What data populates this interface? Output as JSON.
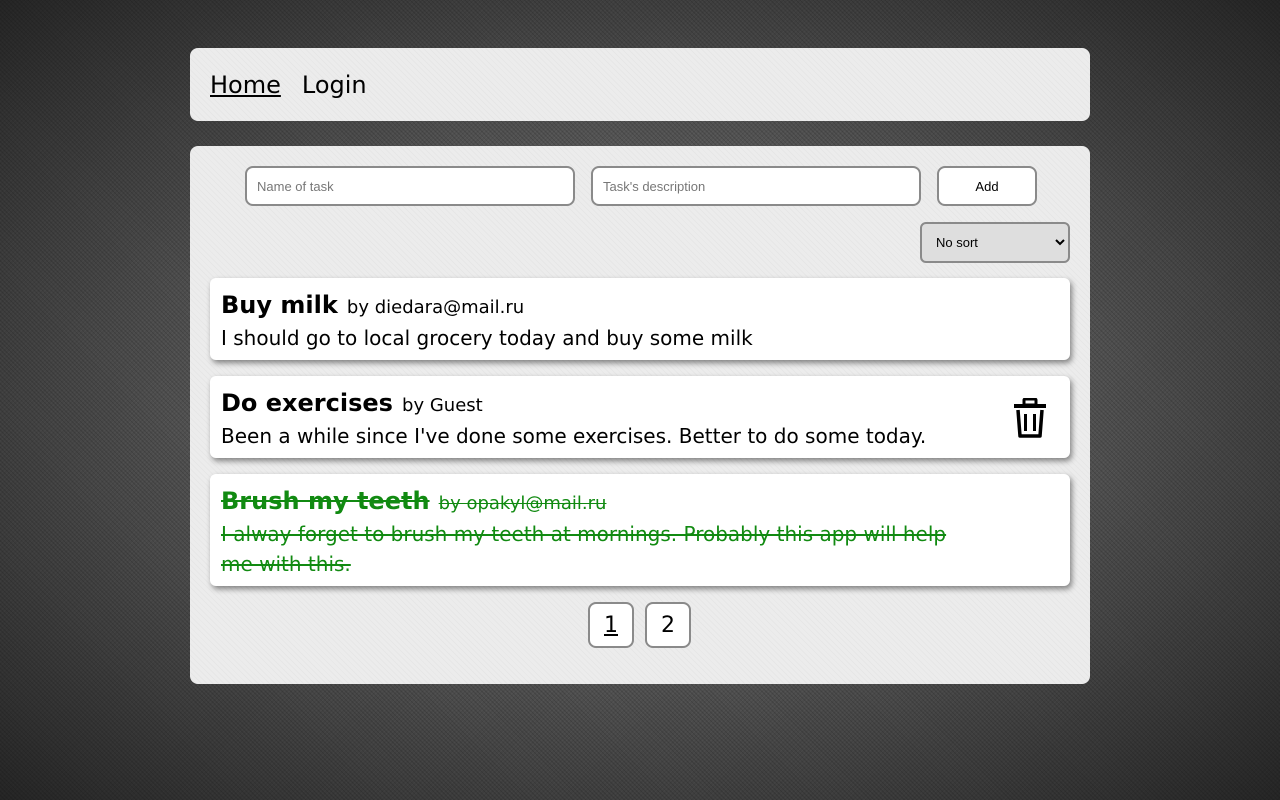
{
  "nav": {
    "links": [
      {
        "label": "Home",
        "active": true
      },
      {
        "label": "Login",
        "active": false
      }
    ]
  },
  "form": {
    "name_placeholder": "Name of task",
    "description_placeholder": "Task's description",
    "add_label": "Add"
  },
  "sort": {
    "selected": "No sort"
  },
  "tasks": [
    {
      "title": "Buy milk",
      "author": "by diedara@mail.ru",
      "description": "I should go to local grocery today and buy some milk",
      "done": false
    },
    {
      "title": "Do exercises",
      "author": "by Guest",
      "description": "Been a while since I've done some exercises. Better to do some today.",
      "done": false,
      "icon": "trash-icon"
    },
    {
      "title": "Brush my teeth",
      "author": "by opakyl@mail.ru",
      "description": "I alway forget to brush my teeth at mornings. Probably this app will help me with this.",
      "done": true
    }
  ],
  "pagination": {
    "pages": [
      "1",
      "2"
    ],
    "current": "1"
  },
  "colors": {
    "done_text": "#118a11",
    "panel": "#ececec"
  }
}
